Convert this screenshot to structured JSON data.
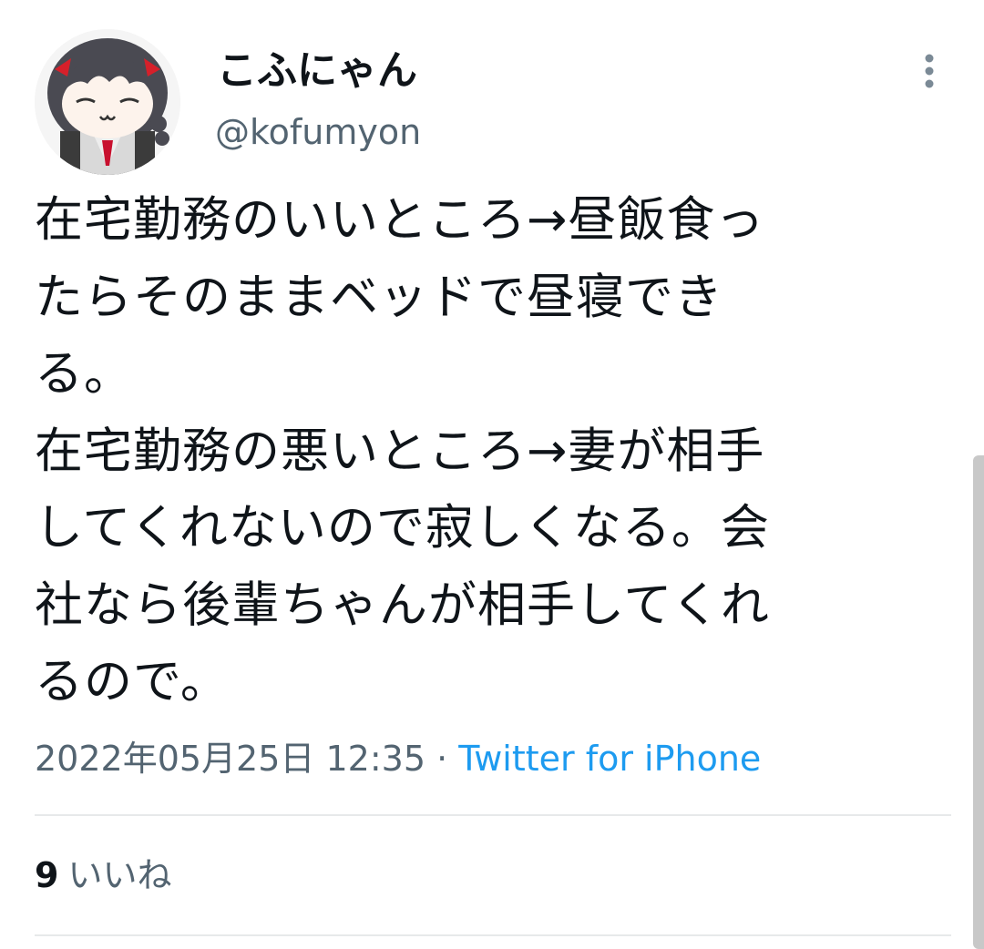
{
  "tweet": {
    "display_name": "こふにゃん",
    "handle": "@kofumyon",
    "text_lines": [
      "在宅勤務のいいところ→昼飯食っ",
      "たらそのままベッドで昼寝でき",
      "る。",
      "在宅勤務の悪いところ→妻が相手",
      "してくれないので寂しくなる。会",
      "社なら後輩ちゃんが相手してくれ",
      "るので。"
    ],
    "timestamp": "2022年05月25日 12:35",
    "separator": " · ",
    "source": "Twitter for iPhone",
    "likes_count": "9",
    "likes_label": "いいね"
  },
  "icons": {
    "avatar": "avatar-anime-girl",
    "more": "vertical-ellipsis-icon"
  },
  "colors": {
    "text_primary": "#0f1419",
    "text_secondary": "#536471",
    "link": "#1d9bf0",
    "divider": "#e7e9ea"
  }
}
